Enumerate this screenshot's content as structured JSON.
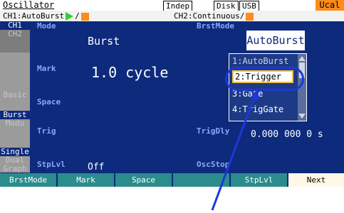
{
  "topbar": {
    "title": "Oscillator",
    "indep": "Indep",
    "disk": "Disk",
    "usb": "USB",
    "ucal": "Ucal"
  },
  "chbar": {
    "ch1": "CH1:AutoBurst",
    "ch1_sep": "/",
    "ch2": "CH2:Continuous/"
  },
  "sidetabs": {
    "ch1": "CH1",
    "ch2": "CH2",
    "basic": "Basic",
    "burst": "Burst",
    "modu": "Modu",
    "single": "Single",
    "dual": "Dual",
    "graph": "Graph"
  },
  "params": {
    "mode_label": "Mode",
    "mode_value": "Burst",
    "mark_label": "Mark",
    "mark_value": "1.0 cycle",
    "space_label": "Space",
    "trig_label": "Trig",
    "stplvl_label": "StpLvl",
    "stplvl_value": "Off",
    "brstmode_label": "BrstMode",
    "brstmode_value": "AutoBurst",
    "trigdly_label": "TrigDly",
    "trigdly_value": "0.000 000 0 s",
    "oscstop_label": "OscStop"
  },
  "dropdown": {
    "items": [
      "1:AutoBurst",
      "2:Trigger",
      "3:Gate",
      "4:TrigGate"
    ],
    "selected_index": 1
  },
  "softkeys": [
    "BrstMode",
    "Mark",
    "Space",
    "",
    "StpLvl",
    "Next"
  ],
  "colors": {
    "background": "#0d2a7c",
    "label": "#8aa6ff",
    "orange": "#ff8c1a",
    "green": "#2fd12f",
    "softkey": "#2a8c8c",
    "callout": "#1c38d8"
  }
}
